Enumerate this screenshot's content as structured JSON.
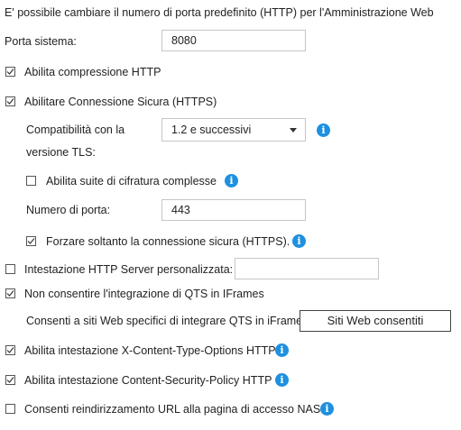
{
  "intro": "E' possibile cambiare il numero di porta predefinito (HTTP) per l'Amministrazione Web",
  "porta_sistema": {
    "label": "Porta sistema:",
    "value": "8080"
  },
  "compressione": {
    "label": "Abilita compressione HTTP",
    "checked": true
  },
  "https": {
    "label": "Abilitare Connessione Sicura (HTTPS)",
    "checked": true
  },
  "tls": {
    "label_line1": "Compatibilità con la",
    "label_line2": "versione TLS:",
    "selected": "1.2 e successivi",
    "info_icon": "i"
  },
  "cifratura": {
    "label": "Abilita suite di cifratura complesse",
    "checked": false,
    "info_icon": "i"
  },
  "numero_porta": {
    "label": "Numero di porta:",
    "value": "443"
  },
  "forzare_https": {
    "label": "Forzare soltanto la connessione sicura (HTTPS).",
    "checked": true,
    "info_icon": "i"
  },
  "server_header": {
    "label": "Intestazione HTTP Server personalizzata:",
    "checked": false,
    "value": ""
  },
  "iframes": {
    "label": "Non consentire l'integrazione di QTS in IFrames",
    "checked": true
  },
  "siti_web": {
    "label": "Consenti a siti Web specifici di integrare QTS in iFrame",
    "button": "Siti Web consentiti"
  },
  "x_content": {
    "label": "Abilita intestazione X-Content-Type-Options HTTP",
    "checked": true,
    "info_icon": "i"
  },
  "csp": {
    "label": "Abilita intestazione Content-Security-Policy HTTP",
    "checked": true,
    "info_icon": "i"
  },
  "redirect": {
    "label": "Consenti reindirizzamento URL alla pagina di accesso NAS",
    "checked": false,
    "info_icon": "i"
  },
  "colors": {
    "info": "#1e90e0",
    "text": "#222222",
    "border": "#c6c6c6"
  }
}
